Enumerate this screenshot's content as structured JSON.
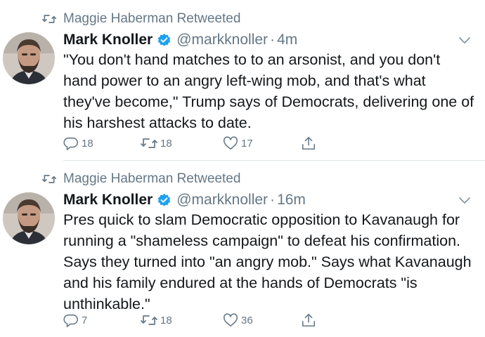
{
  "tweets": [
    {
      "retweeted_by": "Maggie Haberman Retweeted",
      "author_name": "Mark Knoller",
      "handle": "@markknoller",
      "separator": "·",
      "time": "4m",
      "text": "\"You don't hand matches to to an arsonist, and you don't hand power to an angry left-wing mob, and that's what they've become,\" Trump says of Democrats, delivering one of his harshest attacks to date.",
      "reply_count": "18",
      "retweet_count": "18",
      "like_count": "17"
    },
    {
      "retweeted_by": "Maggie Haberman Retweeted",
      "author_name": "Mark Knoller",
      "handle": "@markknoller",
      "separator": "·",
      "time": "16m",
      "text": "Pres quick to slam Democratic opposition to Kavanaugh for running a \"shameless campaign\" to defeat his confirmation. Says they turned into \"an angry mob.\" Says what Kavanaugh and his family endured at the hands of Democrats \"is unthinkable.\"",
      "reply_count": "7",
      "retweet_count": "18",
      "like_count": "36"
    }
  ],
  "colors": {
    "text": "#14171a",
    "secondary": "#657786",
    "verified": "#1da1f2",
    "divider": "#e1e8ed"
  },
  "icons": [
    "retweet-icon",
    "verified-badge-icon",
    "chevron-down-icon",
    "reply-icon",
    "like-icon",
    "share-icon"
  ]
}
